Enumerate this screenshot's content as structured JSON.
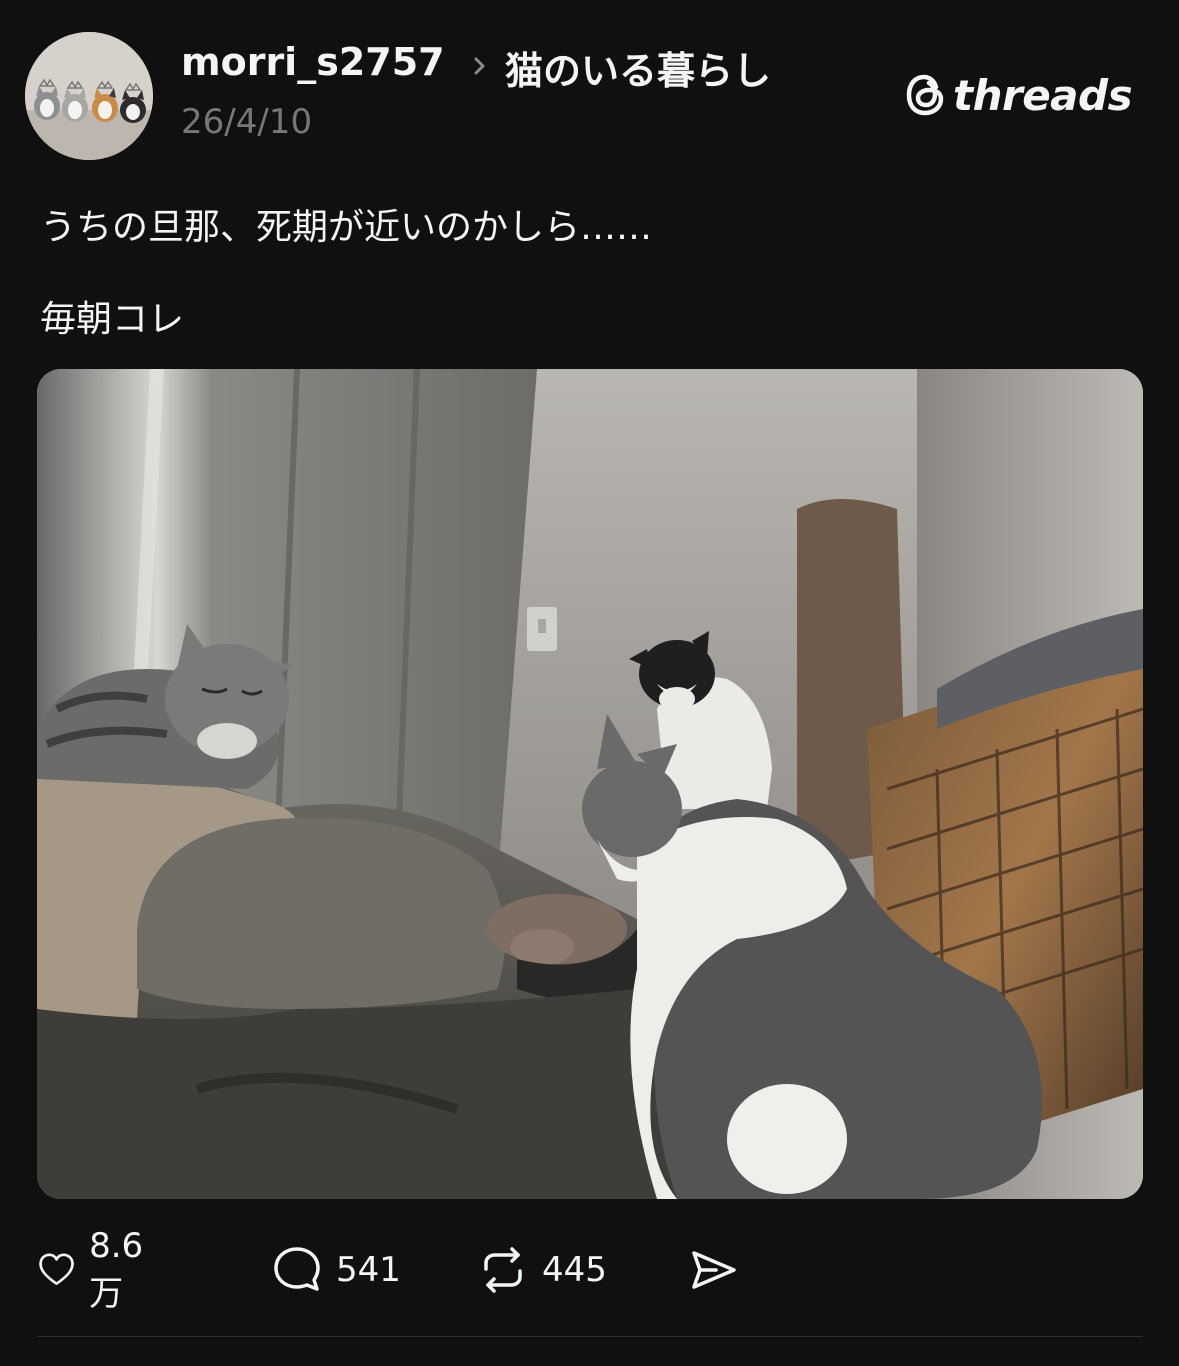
{
  "post": {
    "username": "morri_s2757",
    "topic": "猫のいる暮らし",
    "date": "26/4/10",
    "brand": "threads",
    "text_line1": "うちの旦那、死期が近いのかしら……",
    "text_line2": "毎朝コレ",
    "image": {
      "description_icon": "photo-cats-and-sleeping-person"
    }
  },
  "actions": {
    "like": {
      "icon": "heart-icon",
      "count": "8.6万"
    },
    "reply": {
      "icon": "comment-icon",
      "count": "541"
    },
    "repost": {
      "icon": "repost-icon",
      "count": "445"
    },
    "share": {
      "icon": "send-icon"
    }
  },
  "colors": {
    "background": "#101010",
    "text": "#f3f5f7",
    "muted": "#777777"
  }
}
